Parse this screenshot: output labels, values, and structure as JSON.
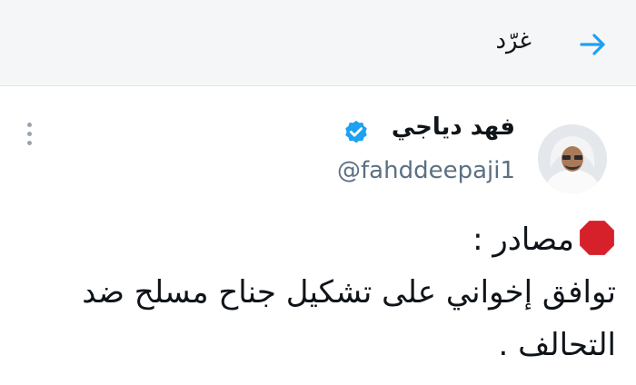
{
  "header": {
    "title": "غرّد",
    "back_icon": "arrow-icon",
    "accent_color": "#1da1f2"
  },
  "tweet": {
    "display_name": "فهد دياجي",
    "handle": "@fahddeepaji1",
    "verified_icon": "verified-badge-icon",
    "more_icon": "more-vertical-icon",
    "lines": [
      "مصادر :",
      "توافق إخواني على تشكيل جناح مسلح ضد",
      "التحالف ."
    ],
    "emoji_icon": "stop-sign-icon"
  }
}
